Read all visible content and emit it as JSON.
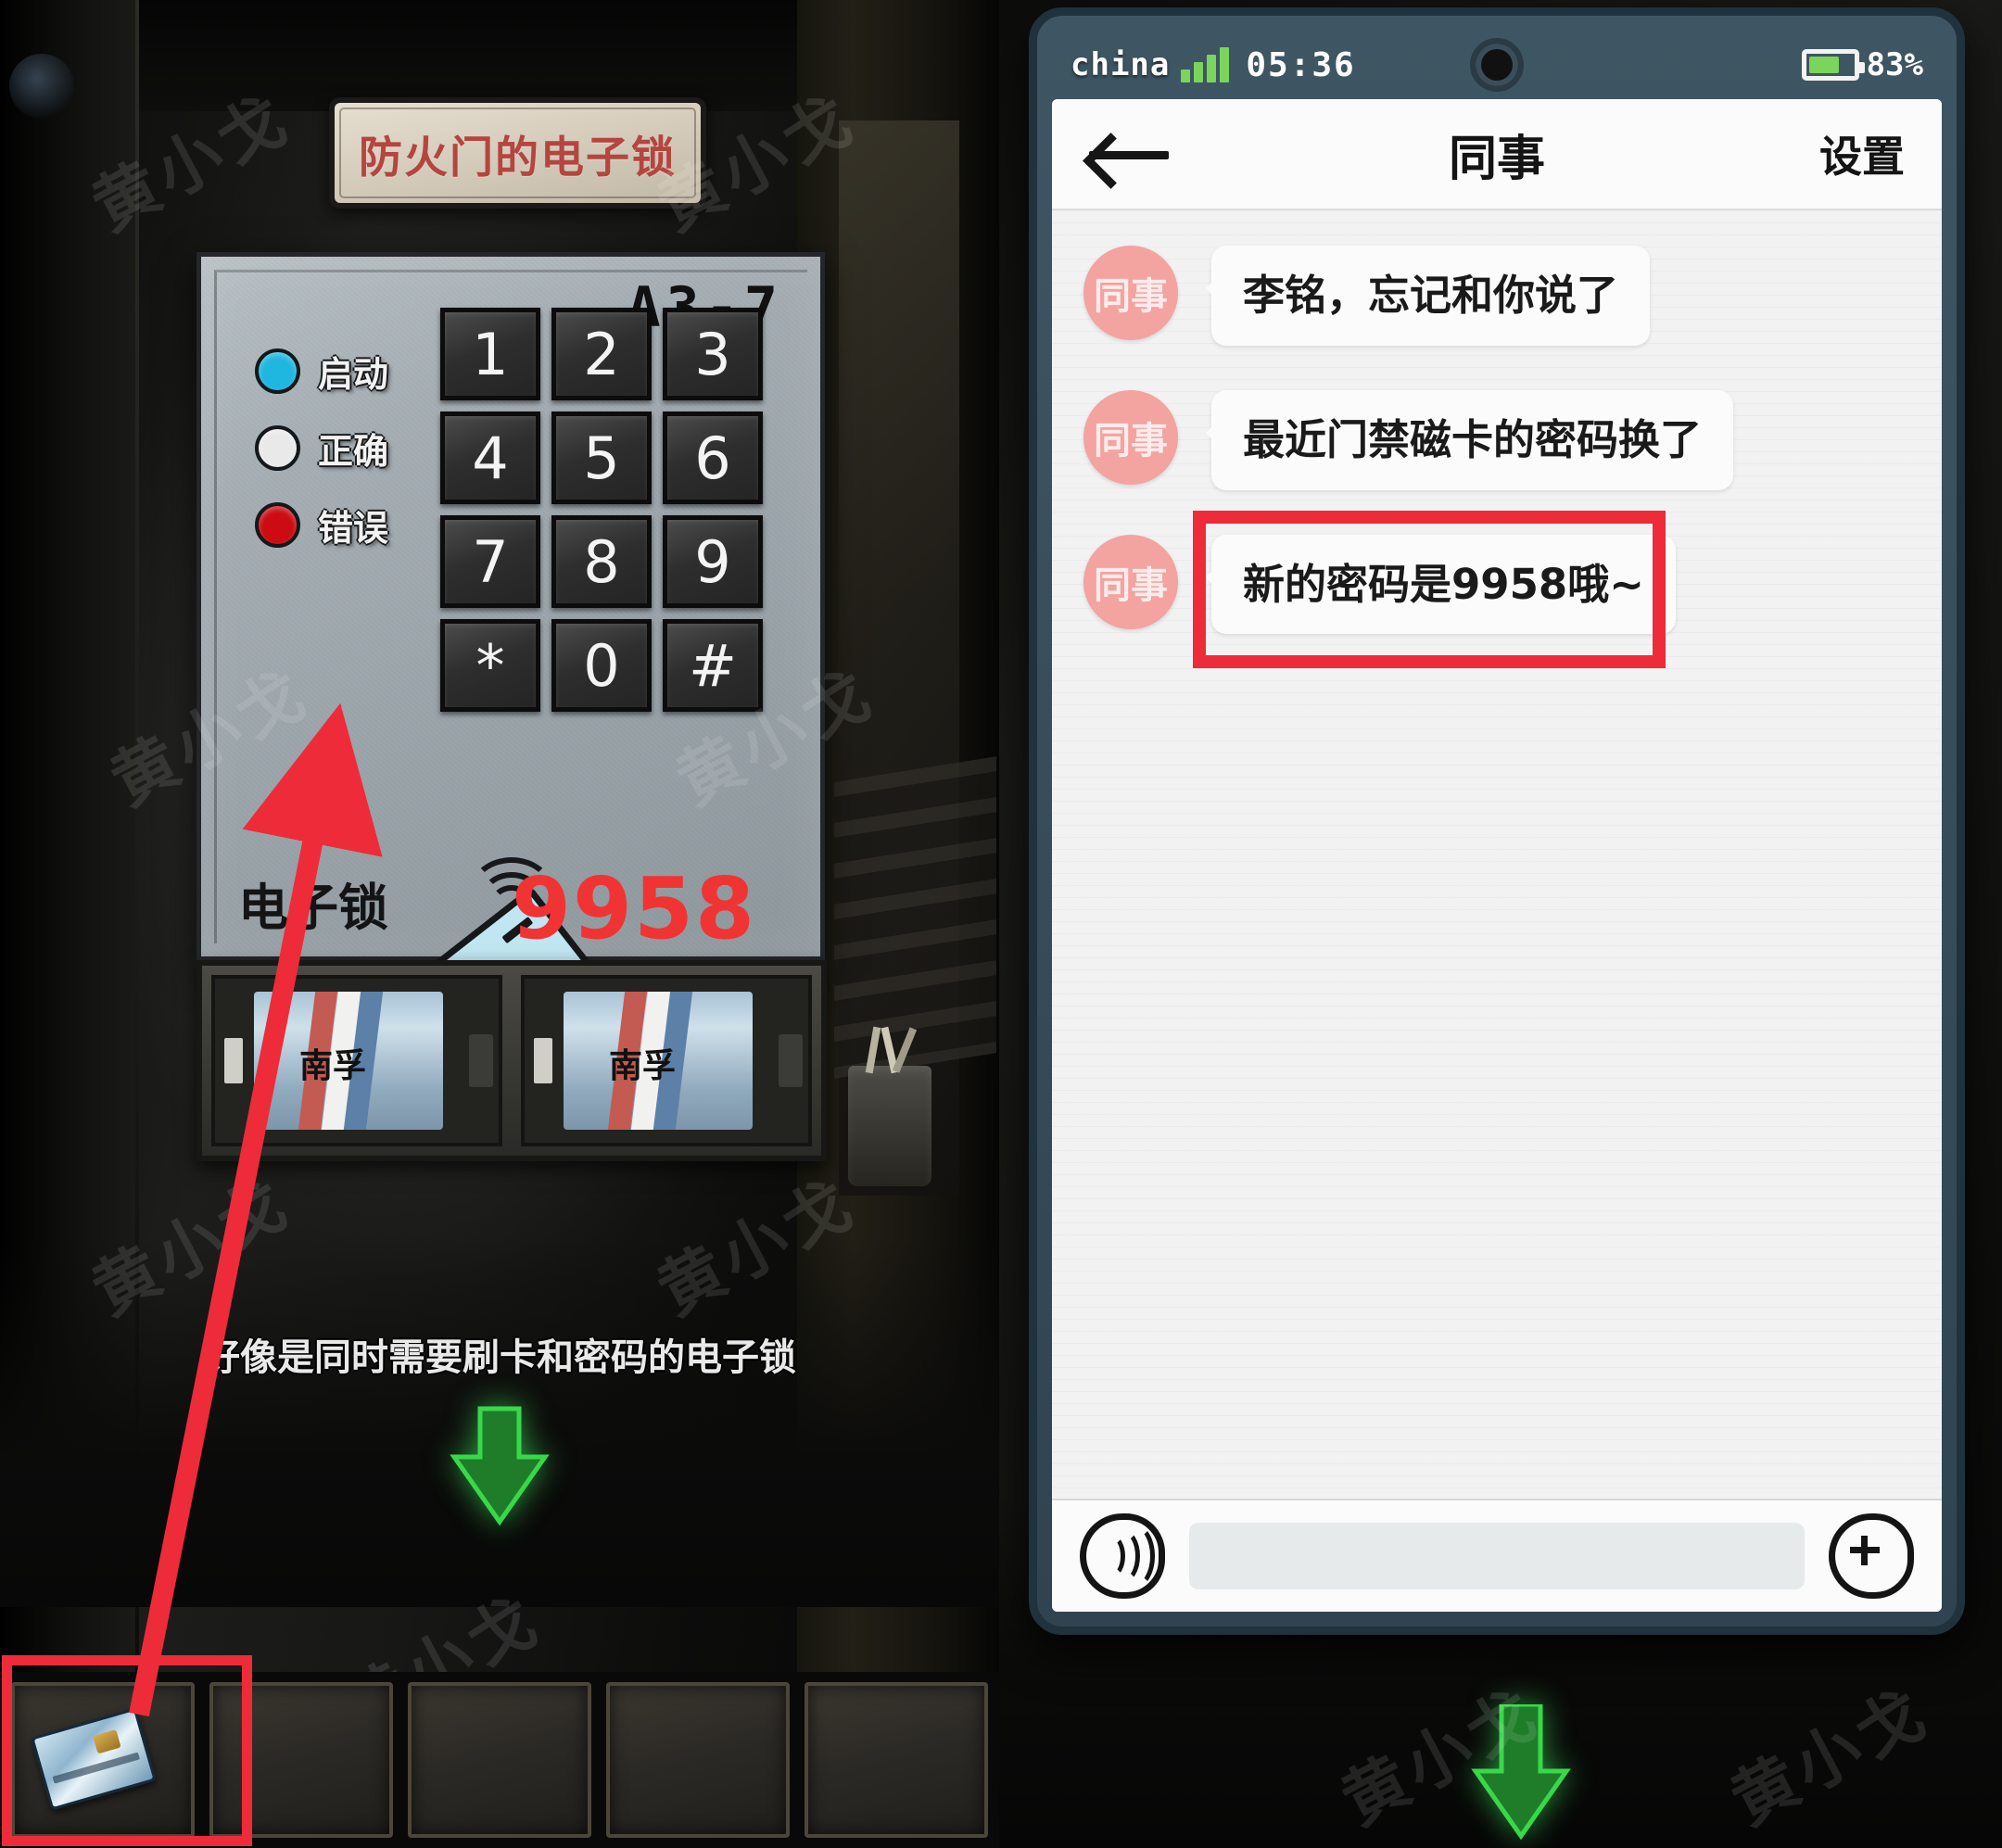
{
  "game": {
    "title_plate": "防火门的电子锁",
    "panel": {
      "code_label": "A3-7",
      "lock_word": "电子锁",
      "code_annotation": "9958",
      "indicators": [
        {
          "label": "启动",
          "color": "#1fb6e0"
        },
        {
          "label": "正确",
          "color": "#e9e9e9"
        },
        {
          "label": "错误",
          "color": "#cc0b12"
        }
      ],
      "keys": [
        "1",
        "2",
        "3",
        "4",
        "5",
        "6",
        "7",
        "8",
        "9",
        "*",
        "0",
        "#"
      ],
      "reader_icon": "nfc-card-reader"
    },
    "battery_slots": [
      "南孚",
      "南孚"
    ],
    "caption": "好像是同时需要刷卡和密码的电子锁",
    "inventory": {
      "slot_count": 5,
      "items": [
        "access-card",
        "",
        "",
        "",
        ""
      ]
    },
    "watermark": "黄小戈"
  },
  "phone": {
    "status_bar": {
      "carrier": "china",
      "time": "05:36",
      "battery_percent": "83%",
      "signal_bars": 4
    },
    "header": {
      "back_icon": "back-arrow-icon",
      "title": "同事",
      "settings": "设置"
    },
    "messages": [
      {
        "avatar": "同事",
        "text": "李铭，忘记和你说了",
        "highlighted": false
      },
      {
        "avatar": "同事",
        "text": "最近门禁磁卡的密码换了",
        "highlighted": false
      },
      {
        "avatar": "同事",
        "text": "新的密码是9958哦~",
        "highlighted": true
      }
    ],
    "input_bar": {
      "voice_icon": "voice-message-icon",
      "placeholder": "",
      "value": "",
      "plus_icon": "plus-circle-icon"
    }
  },
  "annotations": {
    "highlight_color": "#ee2b39",
    "arrow_color": "#ee2b39",
    "code_color": "#f03434"
  }
}
